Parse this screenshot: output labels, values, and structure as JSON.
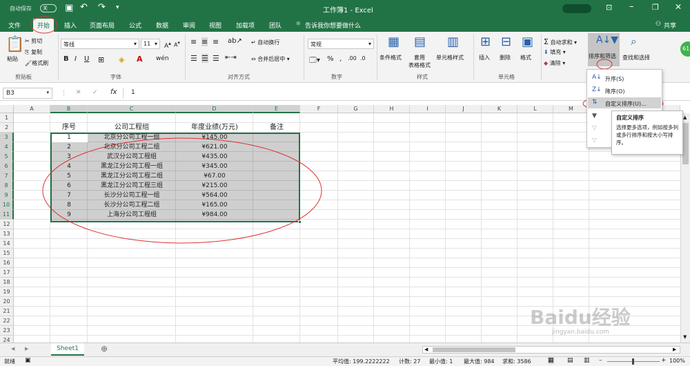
{
  "titlebar": {
    "autosave": "自动保存",
    "autosave_state": "关",
    "title": "工作簿1  -  Excel"
  },
  "tabs": [
    {
      "label": "文件"
    },
    {
      "label": "开始"
    },
    {
      "label": "插入"
    },
    {
      "label": "页面布局"
    },
    {
      "label": "公式"
    },
    {
      "label": "数据"
    },
    {
      "label": "审阅"
    },
    {
      "label": "视图"
    },
    {
      "label": "加载项"
    },
    {
      "label": "团队"
    }
  ],
  "tell_me": "告诉我你想要做什么",
  "share": "共享",
  "ribbon": {
    "paste": "粘贴",
    "cut": "剪切",
    "copy": "复制",
    "format_painter": "格式刷",
    "clipboard": "剪贴板",
    "font_name": "等线",
    "font_size": "11",
    "font_group": "字体",
    "wrap_text": "自动换行",
    "merge_center": "合并后居中",
    "alignment_group": "对齐方式",
    "number_format": "常规",
    "number_group": "数字",
    "conditional": "条件格式",
    "table_format": "套用\n表格格式",
    "cell_style": "单元格样式",
    "styles_group": "样式",
    "insert": "插入",
    "delete": "删除",
    "format": "格式",
    "cells_group": "单元格",
    "autosum": "自动求和",
    "fill": "填充",
    "clear": "清除",
    "sort_filter": "排序和筛选",
    "find_select": "查找和选择"
  },
  "formula_bar": {
    "name_box": "B3",
    "fx": "fx",
    "value": "1"
  },
  "columns": [
    "A",
    "B",
    "C",
    "D",
    "E",
    "F",
    "G",
    "H",
    "I",
    "J",
    "K",
    "L",
    "M"
  ],
  "rows": [
    "1",
    "2",
    "3",
    "4",
    "5",
    "6",
    "7",
    "8",
    "9",
    "10",
    "11",
    "12",
    "13",
    "14",
    "15",
    "16",
    "17",
    "18",
    "19",
    "20",
    "21",
    "22",
    "23",
    "24"
  ],
  "table": {
    "headers": [
      "序号",
      "公司工程组",
      "年度业绩(万元)",
      "备注"
    ],
    "data": [
      [
        "1",
        "北京分公司工程一组",
        "¥145.00"
      ],
      [
        "2",
        "北京分公司工程二组",
        "¥621.00"
      ],
      [
        "3",
        "武汉分公司工程组",
        "¥435.00"
      ],
      [
        "4",
        "黑龙江分公司工程一组",
        "¥345.00"
      ],
      [
        "5",
        "黑龙江分公司工程二组",
        "¥67.00"
      ],
      [
        "6",
        "黑龙江分公司工程三组",
        "¥215.00"
      ],
      [
        "7",
        "长沙分公司工程一组",
        "¥564.00"
      ],
      [
        "8",
        "长沙分公司工程二组",
        "¥165.00"
      ],
      [
        "9",
        "上海分公司工程组",
        "¥984.00"
      ]
    ]
  },
  "sort_menu": {
    "asc": "升序(S)",
    "desc": "降序(O)",
    "custom": "自定义排序(U)...",
    "tooltip_title": "自定义排序",
    "tooltip_body": "选择更多选项，例如按多列或多行排序和按大小写排序。"
  },
  "sheet_tab": "Sheet1",
  "status": {
    "ready": "就绪",
    "average": "平均值: 199.2222222",
    "count": "计数: 27",
    "min": "最小值: 1",
    "max": "最大值: 984",
    "sum": "求和: 3586",
    "zoom": "100%"
  },
  "watermark": "Baidu经验",
  "watermark_url": "jingyan.baidu.com",
  "colors": {
    "excel_green": "#217346",
    "annotation_red": "#e03030"
  }
}
